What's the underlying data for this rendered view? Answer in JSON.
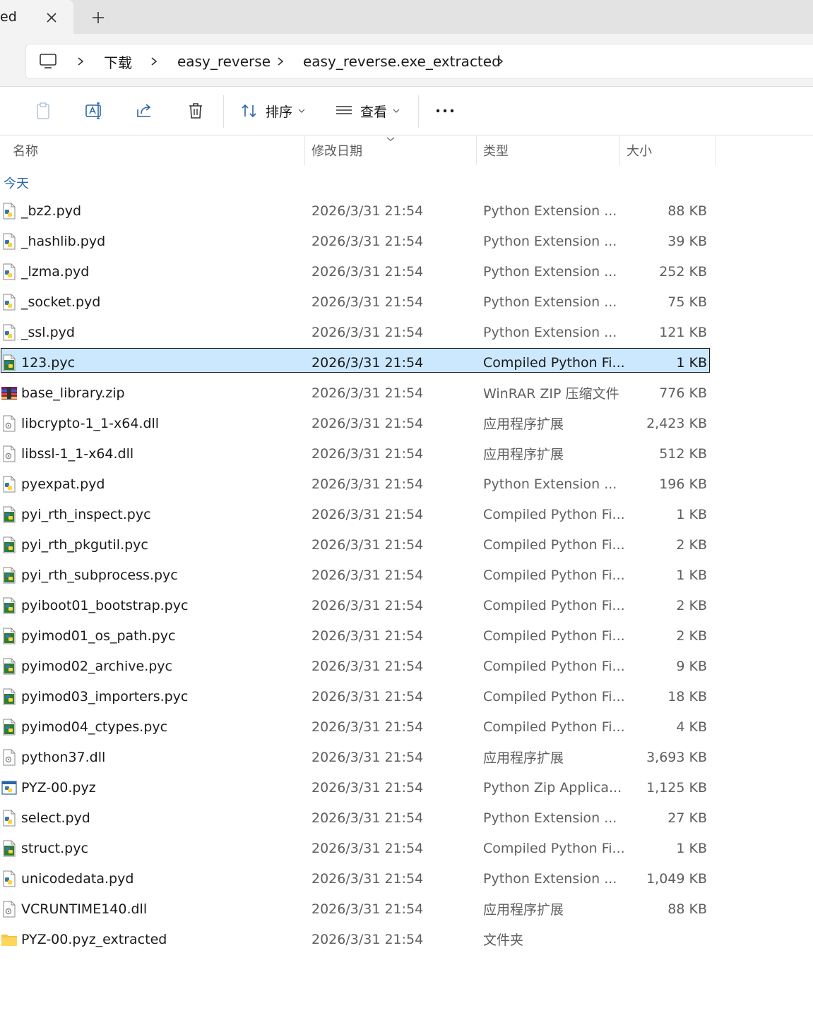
{
  "tab": {
    "title": "ed"
  },
  "breadcrumb": {
    "items": [
      "下载",
      "easy_reverse",
      "easy_reverse.exe_extracted"
    ]
  },
  "toolbar": {
    "sort_label": "排序",
    "view_label": "查看"
  },
  "columns": {
    "name": "名称",
    "date": "修改日期",
    "type": "类型",
    "size": "大小"
  },
  "group": {
    "label": "今天"
  },
  "files": [
    {
      "name": "_bz2.pyd",
      "date": "2026/3/31 21:54",
      "type": "Python Extension ...",
      "size": "88 KB",
      "icon": "python-extension-icon"
    },
    {
      "name": "_hashlib.pyd",
      "date": "2026/3/31 21:54",
      "type": "Python Extension ...",
      "size": "39 KB",
      "icon": "python-extension-icon"
    },
    {
      "name": "_lzma.pyd",
      "date": "2026/3/31 21:54",
      "type": "Python Extension ...",
      "size": "252 KB",
      "icon": "python-extension-icon"
    },
    {
      "name": "_socket.pyd",
      "date": "2026/3/31 21:54",
      "type": "Python Extension ...",
      "size": "75 KB",
      "icon": "python-extension-icon"
    },
    {
      "name": "_ssl.pyd",
      "date": "2026/3/31 21:54",
      "type": "Python Extension ...",
      "size": "121 KB",
      "icon": "python-extension-icon"
    },
    {
      "name": "123.pyc",
      "date": "2026/3/31 21:54",
      "type": "Compiled Python Fi...",
      "size": "1 KB",
      "icon": "compiled-python-icon",
      "selected": true
    },
    {
      "name": "base_library.zip",
      "date": "2026/3/31 21:54",
      "type": "WinRAR ZIP 压缩文件",
      "size": "776 KB",
      "icon": "winrar-archive-icon"
    },
    {
      "name": "libcrypto-1_1-x64.dll",
      "date": "2026/3/31 21:54",
      "type": "应用程序扩展",
      "size": "2,423 KB",
      "icon": "dll-file-icon"
    },
    {
      "name": "libssl-1_1-x64.dll",
      "date": "2026/3/31 21:54",
      "type": "应用程序扩展",
      "size": "512 KB",
      "icon": "dll-file-icon"
    },
    {
      "name": "pyexpat.pyd",
      "date": "2026/3/31 21:54",
      "type": "Python Extension ...",
      "size": "196 KB",
      "icon": "python-extension-icon"
    },
    {
      "name": "pyi_rth_inspect.pyc",
      "date": "2026/3/31 21:54",
      "type": "Compiled Python Fi...",
      "size": "1 KB",
      "icon": "compiled-python-icon"
    },
    {
      "name": "pyi_rth_pkgutil.pyc",
      "date": "2026/3/31 21:54",
      "type": "Compiled Python Fi...",
      "size": "2 KB",
      "icon": "compiled-python-icon"
    },
    {
      "name": "pyi_rth_subprocess.pyc",
      "date": "2026/3/31 21:54",
      "type": "Compiled Python Fi...",
      "size": "1 KB",
      "icon": "compiled-python-icon"
    },
    {
      "name": "pyiboot01_bootstrap.pyc",
      "date": "2026/3/31 21:54",
      "type": "Compiled Python Fi...",
      "size": "2 KB",
      "icon": "compiled-python-icon"
    },
    {
      "name": "pyimod01_os_path.pyc",
      "date": "2026/3/31 21:54",
      "type": "Compiled Python Fi...",
      "size": "2 KB",
      "icon": "compiled-python-icon"
    },
    {
      "name": "pyimod02_archive.pyc",
      "date": "2026/3/31 21:54",
      "type": "Compiled Python Fi...",
      "size": "9 KB",
      "icon": "compiled-python-icon"
    },
    {
      "name": "pyimod03_importers.pyc",
      "date": "2026/3/31 21:54",
      "type": "Compiled Python Fi...",
      "size": "18 KB",
      "icon": "compiled-python-icon"
    },
    {
      "name": "pyimod04_ctypes.pyc",
      "date": "2026/3/31 21:54",
      "type": "Compiled Python Fi...",
      "size": "4 KB",
      "icon": "compiled-python-icon"
    },
    {
      "name": "python37.dll",
      "date": "2026/3/31 21:54",
      "type": "应用程序扩展",
      "size": "3,693 KB",
      "icon": "dll-file-icon"
    },
    {
      "name": "PYZ-00.pyz",
      "date": "2026/3/31 21:54",
      "type": "Python Zip Applica...",
      "size": "1,125 KB",
      "icon": "python-zip-app-icon"
    },
    {
      "name": "select.pyd",
      "date": "2026/3/31 21:54",
      "type": "Python Extension ...",
      "size": "27 KB",
      "icon": "python-extension-icon"
    },
    {
      "name": "struct.pyc",
      "date": "2026/3/31 21:54",
      "type": "Compiled Python Fi...",
      "size": "1 KB",
      "icon": "compiled-python-icon"
    },
    {
      "name": "unicodedata.pyd",
      "date": "2026/3/31 21:54",
      "type": "Python Extension ...",
      "size": "1,049 KB",
      "icon": "python-extension-icon"
    },
    {
      "name": "VCRUNTIME140.dll",
      "date": "2026/3/31 21:54",
      "type": "应用程序扩展",
      "size": "88 KB",
      "icon": "dll-file-icon"
    },
    {
      "name": "PYZ-00.pyz_extracted",
      "date": "2026/3/31 21:54",
      "type": "文件夹",
      "size": "",
      "icon": "folder-icon"
    }
  ]
}
